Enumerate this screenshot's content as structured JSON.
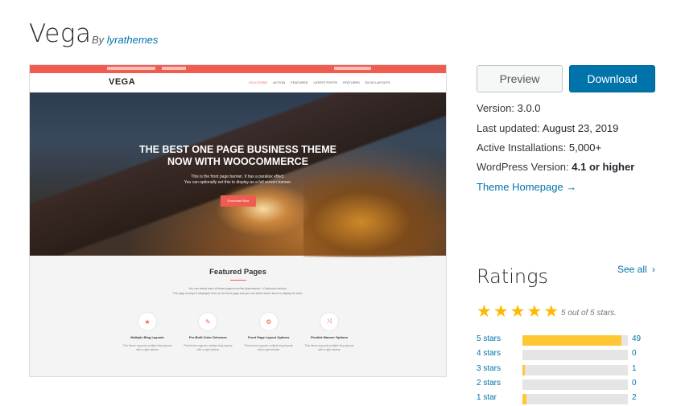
{
  "theme": {
    "title": "Vega",
    "by_label": "By",
    "author": "lyrathemes"
  },
  "screenshot": {
    "logo": "VEGA",
    "menu": [
      "SOLUTIONS",
      "ACTION",
      "FEATURED",
      "LATEST POSTS",
      "FEATURES",
      "BLOG LAYOUTS"
    ],
    "hero_title_line1": "THE BEST ONE PAGE BUSINESS THEME",
    "hero_title_line2": "NOW WITH WOOCOMMERCE",
    "hero_sub_line1": "This is the front page banner. It has a parallax effect.",
    "hero_sub_line2": "You can optionally set this to display as a full screen banner.",
    "hero_button": "Download Now",
    "featured_title": "Featured Pages",
    "featured_desc_line1": "You can select each of these pages from the Appearance > Customize section.",
    "featured_desc_line2": "The page excerpt is displayed here on the front page and you can select which icons to display for each.",
    "cards": [
      {
        "icon": "★",
        "title": "Multiple Blog Layouts",
        "desc": "This theme supports multiple blog layouts with a right sidebar"
      },
      {
        "icon": "✎",
        "title": "Pre-Built Color Schemes",
        "desc": "This theme supports multiple blog layouts with a right sidebar"
      },
      {
        "icon": "⚙",
        "title": "Front Page Layout Options",
        "desc": "This theme supports multiple blog layouts with a right sidebar"
      },
      {
        "icon": "⤨",
        "title": "Flexible Banner Options",
        "desc": "This theme supports multiple blog layouts with a right sidebar"
      }
    ]
  },
  "actions": {
    "preview": "Preview",
    "download": "Download"
  },
  "meta": {
    "version_label": "Version:",
    "version": "3.0.0",
    "updated_label": "Last updated:",
    "updated": "August 23, 2019",
    "installs_label": "Active Installations:",
    "installs": "5,000+",
    "wp_label": "WordPress Version:",
    "wp": "4.1 or higher",
    "homepage": "Theme Homepage →"
  },
  "ratings": {
    "title": "Ratings",
    "see_all": "See all",
    "summary": "5 out of 5 stars.",
    "stars": 5,
    "accent_color": "#ffb900",
    "rows": [
      {
        "label": "5 stars",
        "count": "49",
        "fraction": 0.94
      },
      {
        "label": "4 stars",
        "count": "0",
        "fraction": 0
      },
      {
        "label": "3 stars",
        "count": "1",
        "fraction": 0.02
      },
      {
        "label": "2 stars",
        "count": "0",
        "fraction": 0
      },
      {
        "label": "1 star",
        "count": "2",
        "fraction": 0.04
      }
    ]
  }
}
